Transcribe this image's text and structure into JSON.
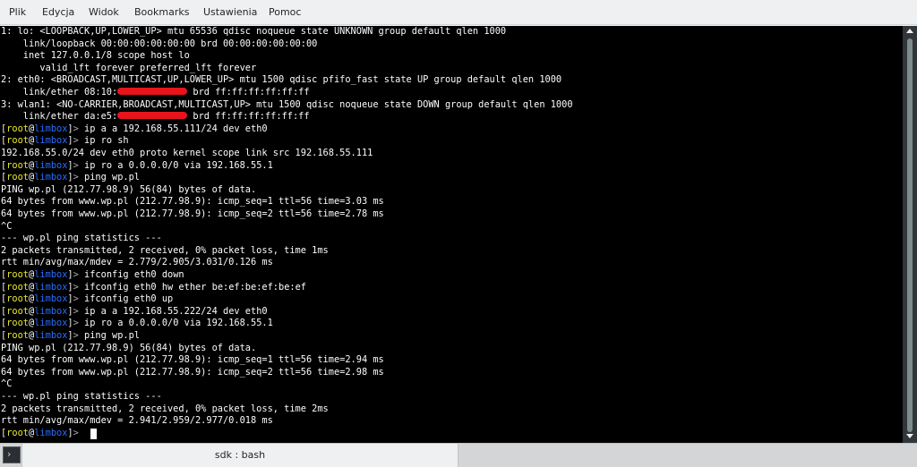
{
  "menu": {
    "items": [
      {
        "label": "Plik"
      },
      {
        "label": "Edycja"
      },
      {
        "label": "Widok"
      },
      {
        "label": "Bookmarks"
      },
      {
        "label": "Ustawienia"
      },
      {
        "label": "Pomoc"
      }
    ]
  },
  "prompt": {
    "open": "[",
    "user": "root",
    "at": "@",
    "host": "limbox",
    "close": "]",
    "arrow": ">"
  },
  "terminal": {
    "lines": [
      {
        "text": "1: lo: <LOOPBACK,UP,LOWER_UP> mtu 65536 qdisc noqueue state UNKNOWN group default qlen 1000"
      },
      {
        "text": "    link/loopback 00:00:00:00:00:00 brd 00:00:00:00:00:00"
      },
      {
        "text": "    inet 127.0.0.1/8 scope host lo"
      },
      {
        "text": "       valid_lft forever preferred_lft forever"
      },
      {
        "text": "2: eth0: <BROADCAST,MULTICAST,UP,LOWER_UP> mtu 1500 qdisc pfifo_fast state UP group default qlen 1000"
      },
      {
        "text_before": "    link/ether 08:10:",
        "text_after": " brd ff:ff:ff:ff:ff:ff"
      },
      {
        "text": "3: wlan1: <NO-CARRIER,BROADCAST,MULTICAST,UP> mtu 1500 qdisc noqueue state DOWN group default qlen 1000"
      },
      {
        "text_before": "    link/ether da:e5:",
        "text_after": " brd ff:ff:ff:ff:ff:ff"
      },
      {
        "cmd": "ip a a 192.168.55.111/24 dev eth0"
      },
      {
        "cmd": "ip ro sh"
      },
      {
        "text": "192.168.55.0/24 dev eth0 proto kernel scope link src 192.168.55.111"
      },
      {
        "cmd": "ip ro a 0.0.0.0/0 via 192.168.55.1"
      },
      {
        "cmd": "ping wp.pl"
      },
      {
        "text": "PING wp.pl (212.77.98.9) 56(84) bytes of data."
      },
      {
        "text": "64 bytes from www.wp.pl (212.77.98.9): icmp_seq=1 ttl=56 time=3.03 ms"
      },
      {
        "text": "64 bytes from www.wp.pl (212.77.98.9): icmp_seq=2 ttl=56 time=2.78 ms"
      },
      {
        "text": "^C"
      },
      {
        "text": "--- wp.pl ping statistics ---"
      },
      {
        "text": "2 packets transmitted, 2 received, 0% packet loss, time 1ms"
      },
      {
        "text": "rtt min/avg/max/mdev = 2.779/2.905/3.031/0.126 ms"
      },
      {
        "cmd": "ifconfig eth0 down"
      },
      {
        "cmd": "ifconfig eth0 hw ether be:ef:be:ef:be:ef"
      },
      {
        "cmd": "ifconfig eth0 up"
      },
      {
        "cmd": "ip a a 192.168.55.222/24 dev eth0"
      },
      {
        "cmd": "ip ro a 0.0.0.0/0 via 192.168.55.1"
      },
      {
        "cmd": "ping wp.pl"
      },
      {
        "text": "PING wp.pl (212.77.98.9) 56(84) bytes of data."
      },
      {
        "text": "64 bytes from www.wp.pl (212.77.98.9): icmp_seq=1 ttl=56 time=2.94 ms"
      },
      {
        "text": "64 bytes from www.wp.pl (212.77.98.9): icmp_seq=2 ttl=56 time=2.98 ms"
      },
      {
        "text": "^C"
      },
      {
        "text": "--- wp.pl ping statistics ---"
      },
      {
        "text": "2 packets transmitted, 2 received, 0% packet loss, time 2ms"
      },
      {
        "text": "rtt min/avg/max/mdev = 2.941/2.959/2.977/0.018 ms"
      },
      {
        "cmd": ""
      }
    ]
  },
  "tabs": [
    {
      "label": "sdk : bash"
    }
  ],
  "colors": {
    "terminal_bg": "#000000",
    "terminal_fg": "#fcfcfc",
    "prompt_user": "#e8e832",
    "prompt_host": "#2a6dff",
    "redaction": "#e8141c"
  },
  "icons": {
    "new_tab": "new-tab-icon",
    "scroll_up": "scroll-up-arrow-icon",
    "scroll_down": "scroll-down-arrow-icon"
  }
}
